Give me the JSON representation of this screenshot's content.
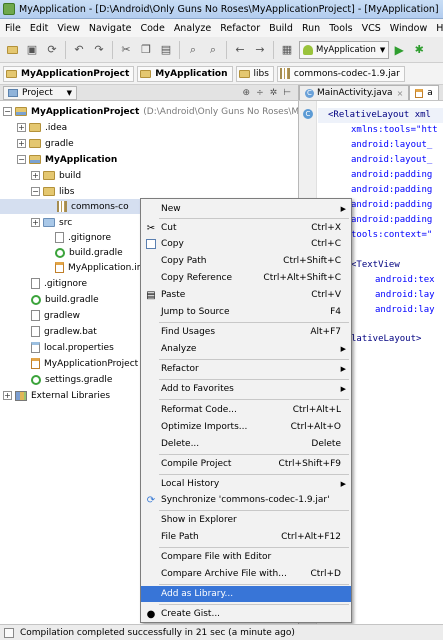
{
  "window": {
    "title": "MyApplication - [D:\\Android\\Only Guns No Roses\\MyApplicationProject] - [MyApplication]"
  },
  "menubar": [
    "File",
    "Edit",
    "View",
    "Navigate",
    "Code",
    "Analyze",
    "Refactor",
    "Build",
    "Run",
    "Tools",
    "VCS",
    "Window",
    "He"
  ],
  "toolbar": {
    "run_config": "MyApplication"
  },
  "breadcrumbs": [
    "MyApplicationProject",
    "MyApplication",
    "libs",
    "commons-codec-1.9.jar"
  ],
  "project_pane": {
    "view_label": "Project"
  },
  "editor": {
    "tabs": [
      "MainActivity.java",
      "a"
    ]
  },
  "tree": [
    {
      "label": "MyApplicationProject",
      "hint": "(D:\\Android\\Only Guns No Roses\\My"
    },
    {
      "label": ".idea"
    },
    {
      "label": "gradle"
    },
    {
      "label": "MyApplication"
    },
    {
      "label": "build"
    },
    {
      "label": "libs"
    },
    {
      "label": "commons-co"
    },
    {
      "label": "src"
    },
    {
      "label": ".gitignore"
    },
    {
      "label": "build.gradle"
    },
    {
      "label": "MyApplication.im"
    },
    {
      "label": ".gitignore"
    },
    {
      "label": "build.gradle"
    },
    {
      "label": "gradlew"
    },
    {
      "label": "gradlew.bat"
    },
    {
      "label": "local.properties"
    },
    {
      "label": "MyApplicationProject"
    },
    {
      "label": "settings.gradle"
    },
    {
      "label": "External Libraries"
    }
  ],
  "code": [
    "<RelativeLayout xml",
    "xmlns:tools=\"htt",
    "android:layout_",
    "android:layout_",
    "android:padding",
    "android:padding",
    "android:padding",
    "android:padding",
    "tools:context=\"",
    "",
    "<TextView",
    "android:tex",
    "android:lay",
    "android:lay",
    "",
    "lativeLayout>"
  ],
  "context_menu": {
    "items": [
      {
        "label": "New",
        "key": "",
        "sub": true
      },
      {
        "label": "Cut",
        "key": "Ctrl+X",
        "icon": "scissors-icon"
      },
      {
        "label": "Copy",
        "key": "Ctrl+C",
        "icon": "copy-icon"
      },
      {
        "label": "Copy Path",
        "key": "Ctrl+Shift+C"
      },
      {
        "label": "Copy Reference",
        "key": "Ctrl+Alt+Shift+C"
      },
      {
        "label": "Paste",
        "key": "Ctrl+V",
        "icon": "paste-icon"
      },
      {
        "label": "Jump to Source",
        "key": "F4"
      },
      {
        "label": "Find Usages",
        "key": "Alt+F7"
      },
      {
        "label": "Analyze",
        "key": "",
        "sub": true
      },
      {
        "label": "Refactor",
        "key": "",
        "sub": true
      },
      {
        "label": "Add to Favorites",
        "key": "",
        "sub": true
      },
      {
        "label": "Reformat Code...",
        "key": "Ctrl+Alt+L"
      },
      {
        "label": "Optimize Imports...",
        "key": "Ctrl+Alt+O"
      },
      {
        "label": "Delete...",
        "key": "Delete"
      },
      {
        "label": "Compile Project",
        "key": "Ctrl+Shift+F9"
      },
      {
        "label": "Local History",
        "key": "",
        "sub": true
      },
      {
        "label": "Synchronize 'commons-codec-1.9.jar'",
        "key": "",
        "icon": "sync-icon"
      },
      {
        "label": "Show in Explorer",
        "key": ""
      },
      {
        "label": "File Path",
        "key": "Ctrl+Alt+F12"
      },
      {
        "label": "Compare File with Editor",
        "key": ""
      },
      {
        "label": "Compare Archive File with...",
        "key": "Ctrl+D"
      },
      {
        "label": "Add as Library...",
        "key": "",
        "highlighted": true
      },
      {
        "label": "Create Gist...",
        "key": "",
        "icon": "github-icon"
      }
    ]
  },
  "status": {
    "text": "Compilation completed successfully in 21 sec (a minute ago)"
  },
  "colors": {
    "menu_highlight": "#3875d7",
    "selection": "#d5dff0",
    "xml_tag": "#000080",
    "xml_attr": "#0000ff"
  }
}
